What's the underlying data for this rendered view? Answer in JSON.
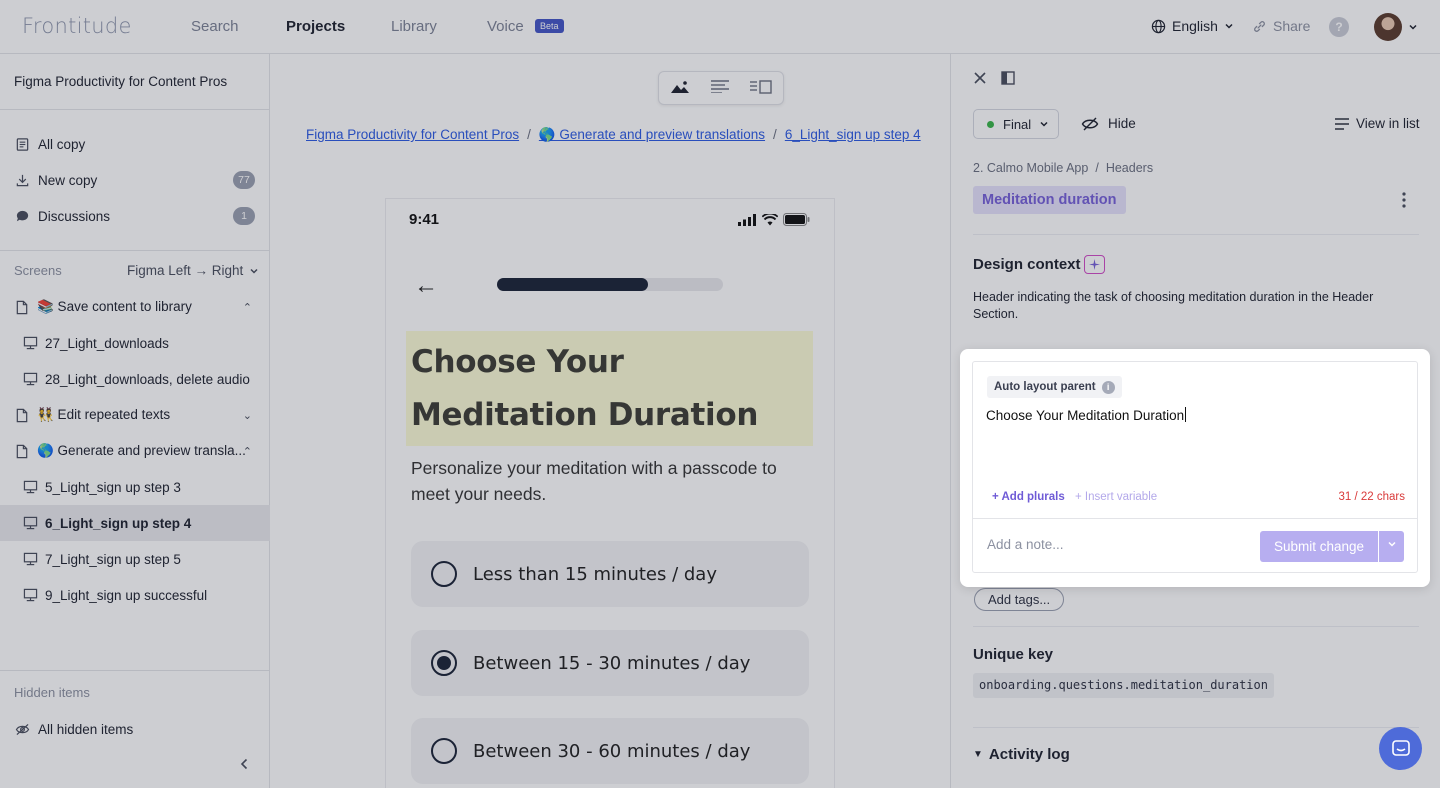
{
  "topbar": {
    "logo": "Frontitude",
    "nav": [
      "Search",
      "Projects",
      "Library",
      "Voice"
    ],
    "beta_badge": "Beta",
    "language": "English",
    "share": "Share",
    "help": "?"
  },
  "sidebar": {
    "project_title": "Figma Productivity for Content Pros",
    "items": [
      {
        "label": "All copy"
      },
      {
        "label": "New copy",
        "count": "77"
      },
      {
        "label": "Discussions",
        "count": "1"
      }
    ],
    "screens_label": "Screens",
    "sort_label": "Figma Left → Right",
    "tree": [
      {
        "label": "📚 Save content to library",
        "type": "page"
      },
      {
        "label": "27_Light_downloads",
        "type": "screen"
      },
      {
        "label": "28_Light_downloads, delete audio",
        "type": "screen"
      },
      {
        "label": "👯 Edit repeated texts",
        "type": "page"
      },
      {
        "label": "🌎 Generate and preview transla...",
        "type": "page"
      },
      {
        "label": "5_Light_sign up step 3",
        "type": "screen"
      },
      {
        "label": "6_Light_sign up step 4",
        "type": "screen",
        "selected": true
      },
      {
        "label": "7_Light_sign up step 5",
        "type": "screen"
      },
      {
        "label": "9_Light_sign up successful",
        "type": "screen"
      }
    ],
    "hidden_label": "Hidden items",
    "hidden_all": "All hidden items"
  },
  "main": {
    "breadcrumbs": [
      "Figma Productivity for Content Pros",
      "🌎 Generate and preview translations",
      "6_Light_sign up step 4"
    ],
    "phone": {
      "time": "9:41",
      "progress_fraction": 0.67,
      "title": "Choose Your Meditation Duration",
      "subtitle": "Personalize your meditation with a passcode to meet your needs.",
      "options": [
        {
          "label": "Less than 15 minutes / day",
          "selected": false
        },
        {
          "label": "Between 15 - 30 minutes / day",
          "selected": true
        },
        {
          "label": "Between 30 - 60 minutes / day",
          "selected": false
        }
      ]
    }
  },
  "panel": {
    "status": "Final",
    "hide": "Hide",
    "view_in_list": "View in list",
    "path_parent": "2. Calmo Mobile App",
    "path_child": "Headers",
    "text_key_name": "Meditation duration",
    "design_context_title": "Design context",
    "design_context_text": "Header indicating the task of choosing meditation duration in the Header Section.",
    "editor": {
      "tag": "Auto layout parent",
      "value": "Choose Your Meditation Duration",
      "add_plurals": "+ Add plurals",
      "insert_variable": "+ Insert variable",
      "chars": "31 / 22 chars",
      "note_placeholder": "Add a note...",
      "submit": "Submit change"
    },
    "add_tags": "Add tags...",
    "unique_key_title": "Unique key",
    "unique_key": "onboarding.questions.meditation_duration",
    "activity_log": "Activity log"
  },
  "colors": {
    "accent": "#7760d9",
    "status_final": "#39b54a",
    "submit_disabled": "#b7aef0"
  }
}
